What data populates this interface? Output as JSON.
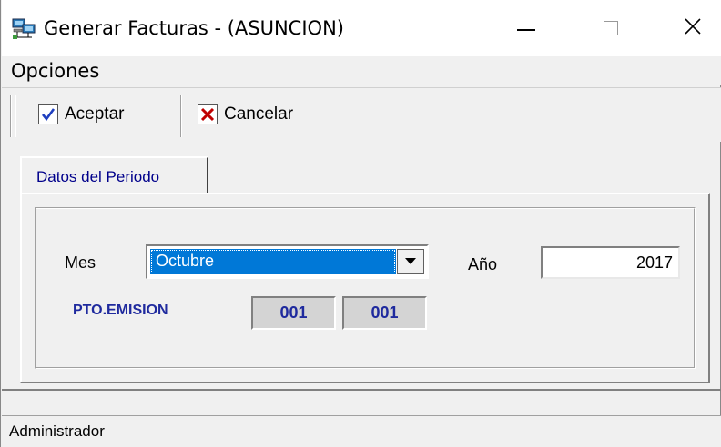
{
  "window": {
    "title": "Generar Facturas - (ASUNCION)",
    "icon": "computer-network-icon",
    "controls": {
      "minimize": "minimize-icon",
      "maximize": "maximize-icon",
      "close": "close-icon"
    }
  },
  "menu": {
    "items": [
      {
        "label": "Opciones"
      }
    ]
  },
  "toolbar": {
    "accept_label": "Aceptar",
    "accept_icon": "checkmark-icon",
    "accept_color": "#1f3fbf",
    "cancel_label": "Cancelar",
    "cancel_icon": "x-mark-icon",
    "cancel_color": "#c00000"
  },
  "tabs": [
    {
      "label": "Datos del Periodo",
      "selected": true
    }
  ],
  "form": {
    "month_label": "Mes",
    "month_value": "Octubre",
    "year_label": "Año",
    "year_value": "2017",
    "pto_label": "PTO.EMISION",
    "pto_values": [
      "001",
      "001"
    ]
  },
  "status": {
    "text": "Administrador"
  },
  "colors": {
    "selection": "#0078d7",
    "accent_text": "#1f2a9e",
    "tab_text": "#00008b"
  }
}
